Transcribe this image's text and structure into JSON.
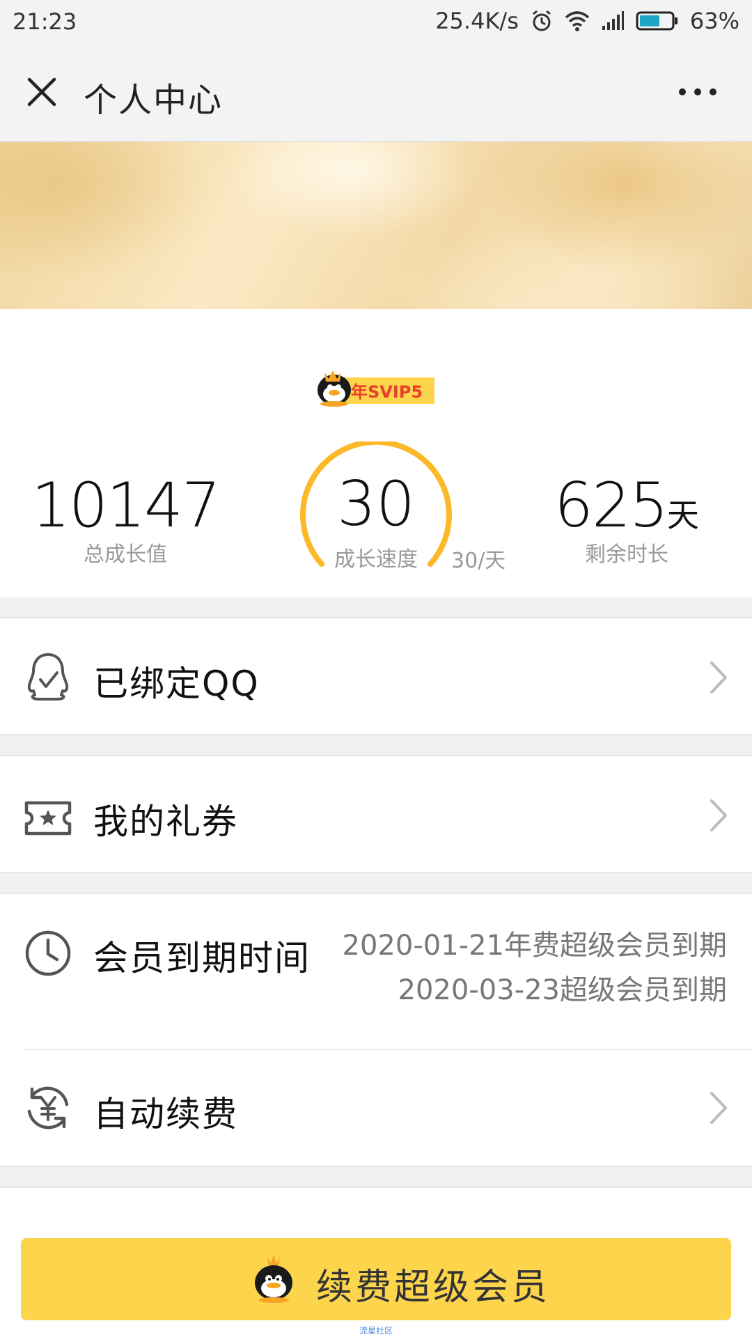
{
  "status_bar": {
    "time": "21:23",
    "network_speed": "25.4K/s",
    "battery_percent": "63%",
    "battery_level": 0.63,
    "icons": [
      "alarm-icon",
      "wifi-icon",
      "signal-icon",
      "battery-icon"
    ]
  },
  "header": {
    "title": "个人中心",
    "close_icon": "close-icon",
    "more_icon": "more-icon"
  },
  "profile": {
    "badge_text": "年SVIP5",
    "stats": {
      "total_growth_value": "10147",
      "total_growth_label": "总成长值",
      "growth_speed_value": "30",
      "growth_speed_label": "成长速度",
      "growth_speed_rate": "30/天",
      "remaining_value": "625",
      "remaining_unit": "天",
      "remaining_label": "剩余时长"
    }
  },
  "menu": {
    "bound_qq": {
      "label": "已绑定QQ",
      "icon": "qq-penguin-outline-icon"
    },
    "vouchers": {
      "label": "我的礼券",
      "icon": "ticket-star-icon"
    },
    "membership_expiry": {
      "label": "会员到期时间",
      "icon": "clock-icon",
      "lines": [
        "2020-01-21年费超级会员到期",
        "2020-03-23超级会员到期"
      ]
    },
    "auto_renew": {
      "label": "自动续费",
      "icon": "yuan-refresh-icon"
    }
  },
  "renew_button": {
    "label": "续费超级会员",
    "icon": "qq-penguin-icon"
  },
  "watermark": "流星社区",
  "colors": {
    "accent_yellow": "#fcd54c",
    "gauge_orange": "#fbb829",
    "badge_red": "#e8412b"
  }
}
